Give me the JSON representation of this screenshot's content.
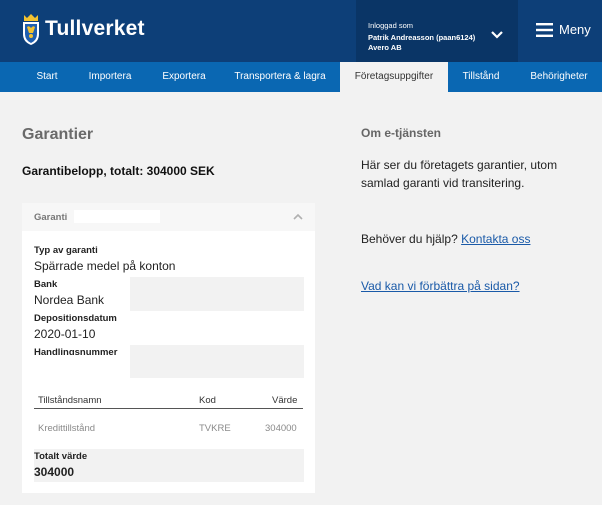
{
  "header": {
    "logo_text": "Tullverket",
    "user": {
      "label": "Inloggad som",
      "name": "Patrik Andreasson (paan6124)",
      "organization": "Avero AB"
    },
    "menu_label": "Meny"
  },
  "nav": {
    "tabs": [
      {
        "label": "Start"
      },
      {
        "label": "Importera"
      },
      {
        "label": "Exportera"
      },
      {
        "label": "Transportera & lagra"
      },
      {
        "label": "Företagsuppgifter",
        "active": true
      },
      {
        "label": "Tillstånd"
      },
      {
        "label": "Behörigheter"
      }
    ]
  },
  "main": {
    "title": "Garantier",
    "total_amount": "Garantibelopp, totalt: 304000 SEK",
    "guarantee_card": {
      "header_label": "Garanti",
      "fields": [
        {
          "label": "Typ av garanti",
          "value": "Spärrade medel på konton"
        },
        {
          "label": "Bank",
          "value": "Nordea Bank"
        },
        {
          "label": "Depositionsdatum",
          "value": "2020-01-10"
        },
        {
          "label": "Handlingsnummer",
          "value": ""
        }
      ],
      "table": {
        "columns": [
          "Tillståndsnamn",
          "Kod",
          "Värde"
        ],
        "rows": [
          [
            "Kredittillstånd",
            "TVKRE",
            "304000"
          ]
        ]
      },
      "total": {
        "label": "Totalt värde",
        "value": "304000"
      }
    }
  },
  "sidebar": {
    "title": "Om e-tjänsten",
    "description": "Här ser du företagets garantier, utom samlad garanti vid transitering.",
    "help_text": "Behöver du hjälp?",
    "help_link": "Kontakta oss",
    "improve_link": "Vad kan vi förbättra på sidan?"
  },
  "colors": {
    "header_bg": "#0d3f78",
    "nav_bg": "#0a67b2",
    "page_bg": "#f2f2f2",
    "link": "#1a5aa8",
    "crest_gold": "#f2c230"
  },
  "icons": {
    "logo": "crown-crest-icon",
    "user_menu": "chevron-down-icon",
    "menu": "hamburger-icon",
    "collapse": "chevron-up-icon"
  }
}
